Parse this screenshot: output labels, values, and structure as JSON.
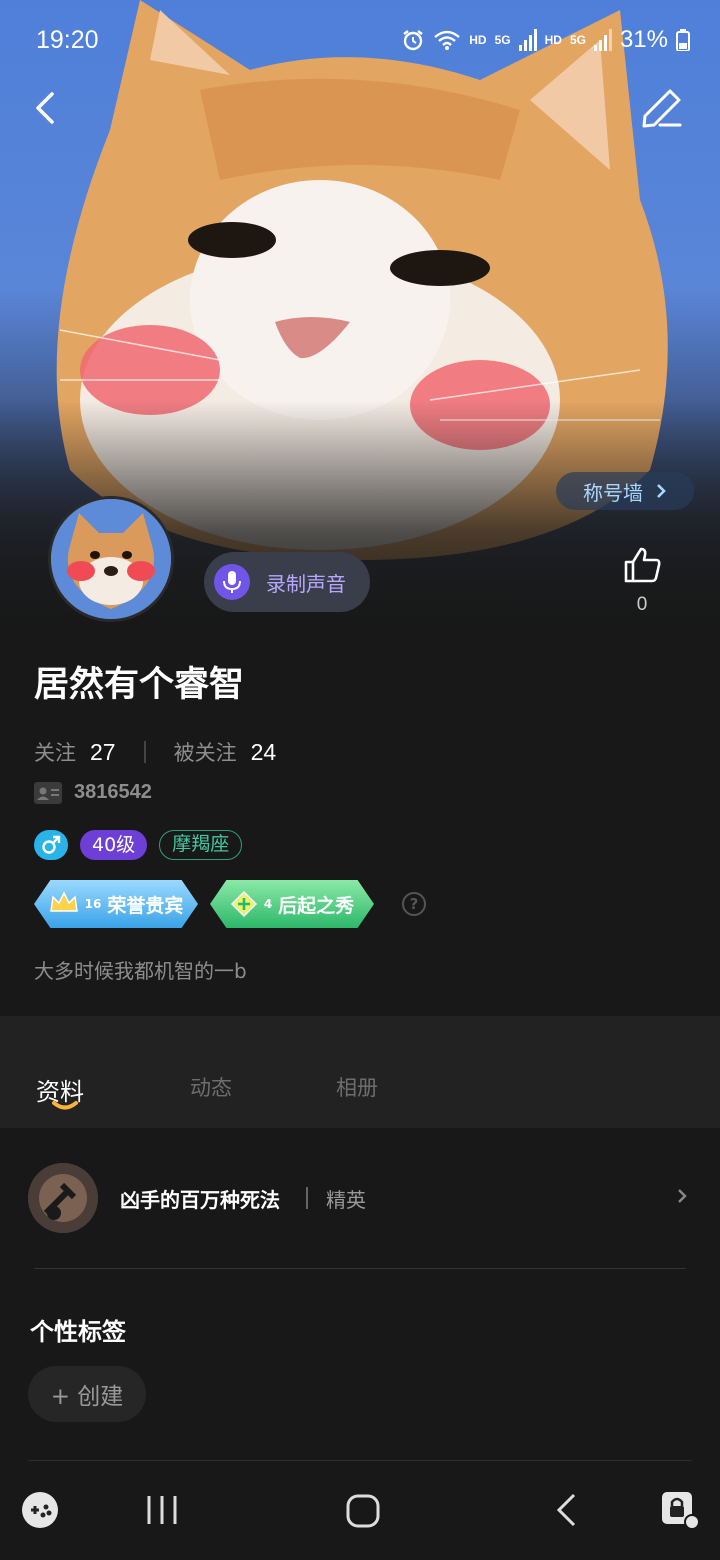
{
  "status_bar": {
    "time": "19:20",
    "hd1": "HD",
    "hd2": "HD",
    "net1": "5G",
    "net2": "5G",
    "battery": "31%"
  },
  "hero": {
    "title_wall_label": "称号墙"
  },
  "profile": {
    "voice_label": "录制声音",
    "like_count": "0",
    "username": "居然有个睿智",
    "following_label": "关注",
    "following_count": "27",
    "followers_label": "被关注",
    "followers_count": "24",
    "user_id": "3816542",
    "level": "40级",
    "zodiac": "摩羯座",
    "medals": [
      {
        "label": "荣誉贵宾",
        "num": "16"
      },
      {
        "label": "后起之秀",
        "num": "4"
      }
    ],
    "help_glyph": "?",
    "bio": "大多时候我都机智的一b"
  },
  "tabs": [
    {
      "label": "资料"
    },
    {
      "label": "动态"
    },
    {
      "label": "相册"
    }
  ],
  "game": {
    "name": "凶手的百万种死法",
    "rank": "精英"
  },
  "tags": {
    "title": "个性标签",
    "create_label": "+ 创建"
  },
  "colors": {
    "accent_purple": "#6e3fd6",
    "gender_blue": "#2ab3e8",
    "zodiac_green": "#43c79f",
    "title_wall_text": "#a9d8ff"
  }
}
